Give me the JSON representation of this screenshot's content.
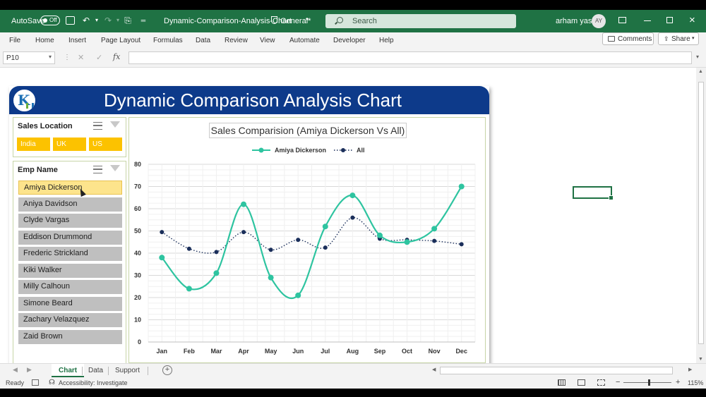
{
  "titlebar": {
    "autosave_label": "AutoSave",
    "autosave_state": "Off",
    "doc_title": "Dynamic-Comparison-Analysis-Chart",
    "sensitivity": "General*",
    "search_placeholder": "Search",
    "user_name": "arham yasir",
    "user_initials": "AY"
  },
  "menu": {
    "items": [
      "File",
      "Home",
      "Insert",
      "Page Layout",
      "Formulas",
      "Data",
      "Review",
      "View",
      "Automate",
      "Developer",
      "Help"
    ],
    "comments_label": "Comments",
    "share_label": "Share"
  },
  "formula_bar": {
    "name_box": "P10",
    "formula": ""
  },
  "dashboard": {
    "title": "Dynamic Comparison Analysis Chart",
    "location_slicer": {
      "title": "Sales Location",
      "items": [
        "India",
        "UK",
        "US"
      ]
    },
    "emp_slicer": {
      "title": "Emp Name",
      "selected": "Amiya Dickerson",
      "items": [
        "Amiya Dickerson",
        "Aniya Davidson",
        "Clyde Vargas",
        "Eddison Drummond",
        "Frederic Strickland",
        "Kiki Walker",
        "Milly Calhoun",
        "Simone Beard",
        "Zachary Velazquez",
        "Zaid Brown"
      ]
    }
  },
  "chart_data": {
    "type": "line",
    "title": "Sales Comparision (Amiya Dickerson Vs All)",
    "categories": [
      "Jan",
      "Feb",
      "Mar",
      "Apr",
      "May",
      "Jun",
      "Jul",
      "Aug",
      "Sep",
      "Oct",
      "Nov",
      "Dec"
    ],
    "series": [
      {
        "name": "Amiya Dickerson",
        "color": "#2ec4a0",
        "style": "solid-smooth",
        "values": [
          38,
          24,
          31,
          62,
          29,
          21,
          52,
          66,
          48,
          45,
          51,
          70
        ]
      },
      {
        "name": "All",
        "color": "#1a2e5a",
        "style": "dotted-smooth",
        "values": [
          49.5,
          42,
          40.5,
          49.5,
          41.5,
          46,
          42.5,
          56,
          46.5,
          46,
          45.5,
          44
        ]
      }
    ],
    "ylim": [
      0,
      80
    ],
    "yticks": [
      0,
      10,
      20,
      30,
      40,
      50,
      60,
      70,
      80
    ],
    "grid": true,
    "legend_position": "top"
  },
  "tabs": {
    "items": [
      "Chart",
      "Data",
      "Support"
    ],
    "active": "Chart"
  },
  "status": {
    "ready": "Ready",
    "accessibility": "Accessibility: Investigate",
    "zoom": "115%"
  }
}
